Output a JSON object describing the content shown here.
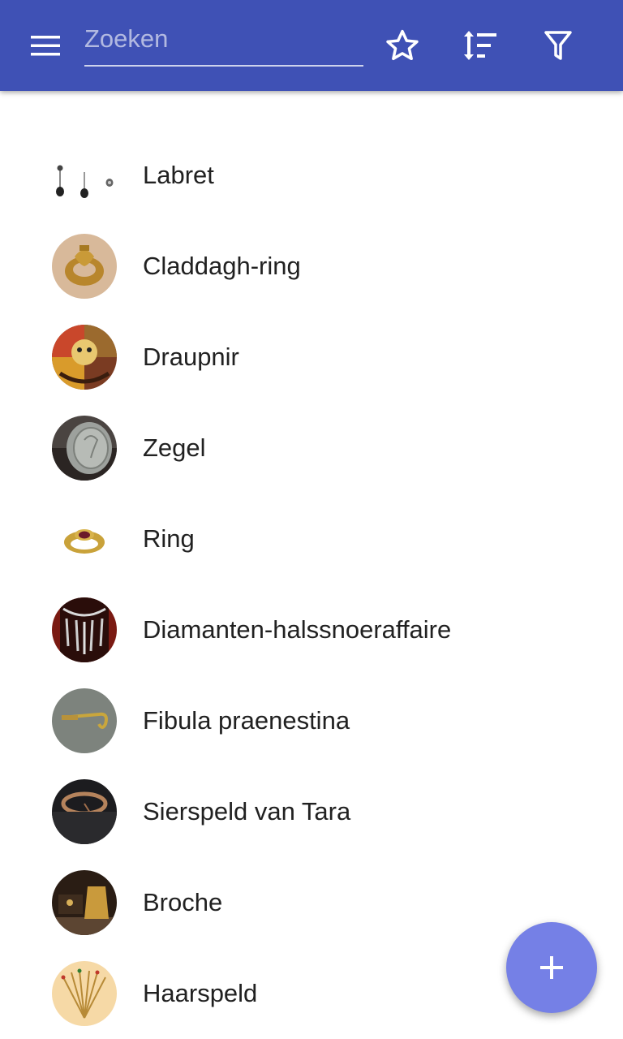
{
  "appbar": {
    "search_placeholder": "Zoeken",
    "icons": [
      "menu-icon",
      "star-outline-icon",
      "sort-icon",
      "filter-icon"
    ],
    "color": "#3f51b5"
  },
  "items": [
    {
      "label": "Labret"
    },
    {
      "label": "Claddagh-ring"
    },
    {
      "label": "Draupnir"
    },
    {
      "label": "Zegel"
    },
    {
      "label": "Ring"
    },
    {
      "label": "Diamanten-halssnoeraffaire"
    },
    {
      "label": "Fibula praenestina"
    },
    {
      "label": "Sierspeld van Tara"
    },
    {
      "label": "Broche"
    },
    {
      "label": "Haarspeld"
    }
  ],
  "fab": {
    "icon": "plus-icon",
    "color": "#7580e6"
  }
}
